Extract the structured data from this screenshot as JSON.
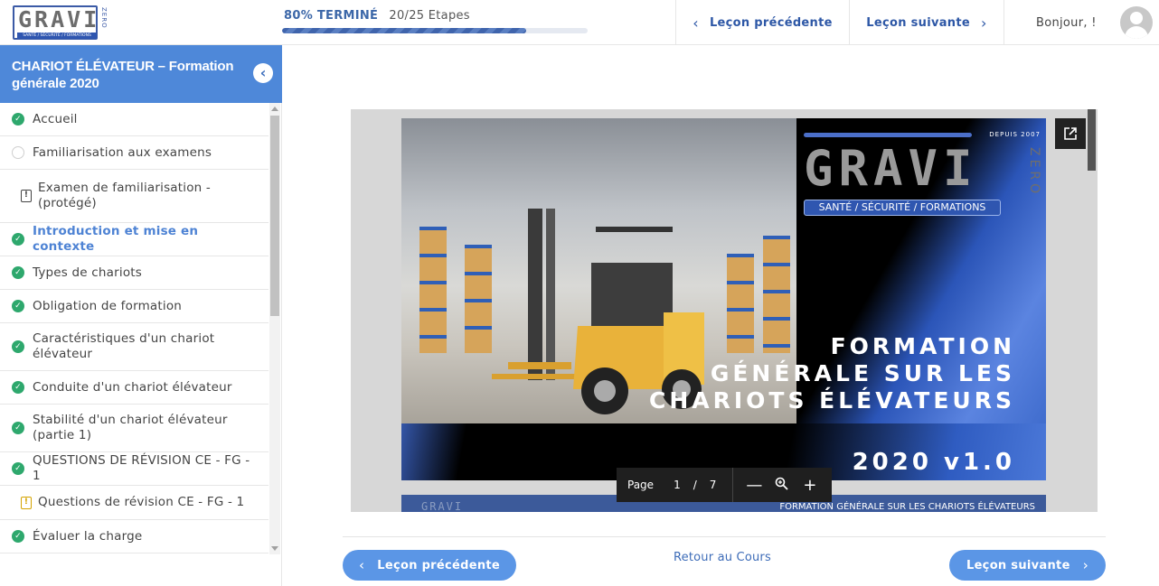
{
  "logo": {
    "text": "GRAVI",
    "subtitle": "SANTÉ / SÉCURITÉ / FORMATIONS",
    "side": "ZERO"
  },
  "progress": {
    "percent_label": "80% TERMINÉ",
    "steps_label": "20/25 Etapes",
    "fraction": 0.8
  },
  "header_nav": {
    "prev_label": "Leçon précédente",
    "next_label": "Leçon suivante"
  },
  "user": {
    "greeting": "Bonjour, !"
  },
  "sidebar": {
    "course_title": "CHARIOT ÉLÉVATEUR – Formation générale 2020",
    "lessons": [
      {
        "label": "Accueil",
        "status": "done"
      },
      {
        "label": "Familiarisation aux examens",
        "status": "todo"
      },
      {
        "label": "Examen de familiarisation - (protégé)",
        "status": "quiz"
      },
      {
        "label": "Introduction et mise en contexte",
        "status": "done-active"
      },
      {
        "label": "Types de chariots",
        "status": "done"
      },
      {
        "label": "Obligation de formation",
        "status": "done"
      },
      {
        "label": "Caractéristiques d'un chariot élévateur",
        "status": "done"
      },
      {
        "label": "Conduite d'un chariot élévateur",
        "status": "done"
      },
      {
        "label": "Stabilité d'un chariot élévateur (partie 1)",
        "status": "done"
      },
      {
        "label": "QUESTIONS DE RÉVISION CE - FG - 1",
        "status": "done"
      },
      {
        "label": "Questions de révision CE - FG - 1",
        "status": "quiz-yellow"
      },
      {
        "label": "Évaluer la charge",
        "status": "done"
      }
    ]
  },
  "slide": {
    "depuis": "DEPUIS 2007",
    "logo_text": "GRAVI",
    "logo_side": "ZERO",
    "logo_subtitle": "SANTÉ / SÉCURITÉ / FORMATIONS",
    "title_l1": "FORMATION",
    "title_l2": "GÉNÉRALE SUR LES",
    "title_l3": "CHARIOTS ÉLÉVATEURS",
    "version": "2020 v1.0",
    "next_logo": "GRAVI",
    "next_title": "FORMATION GÉNÉRALE SUR LES CHARIOTS ÉLÉVATEURS"
  },
  "pager": {
    "label": "Page",
    "current": "1",
    "separator": "/",
    "total": "7",
    "minus": "—",
    "plus": "+"
  },
  "footer_nav": {
    "prev_label": "Leçon précédente",
    "back_label": "Retour au Cours",
    "next_label": "Leçon suivante"
  },
  "colors": {
    "accent": "#4e88d9",
    "check": "#2ea86d",
    "link": "#2d57a6",
    "pill": "#5b96e6"
  }
}
